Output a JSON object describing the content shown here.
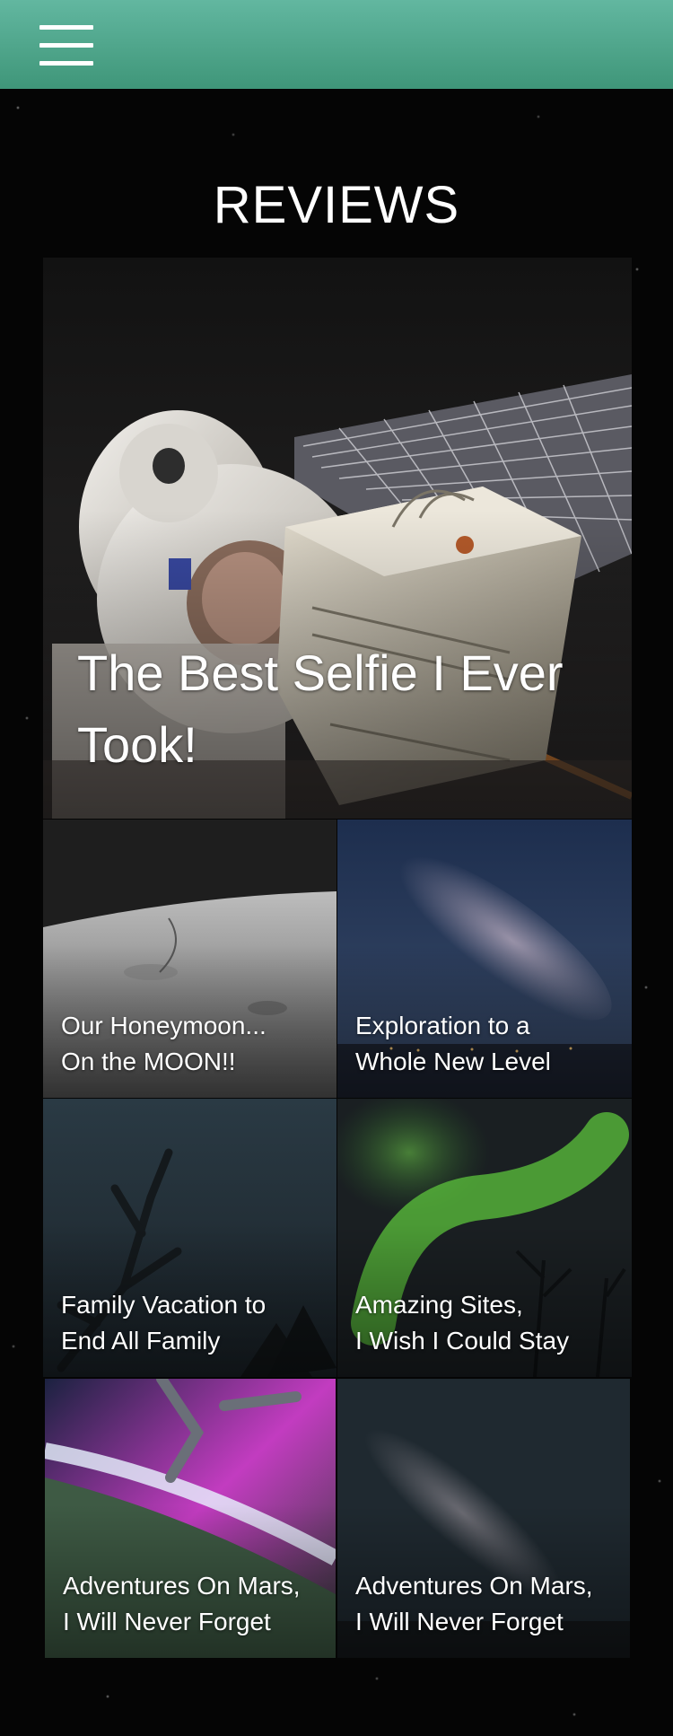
{
  "header": {
    "menu_icon": "hamburger-menu-icon",
    "accent_color": "#4fa88c"
  },
  "page": {
    "title": "REVIEWS"
  },
  "featured": {
    "title": "The Best Selfie I Ever\nTook!"
  },
  "cards": [
    {
      "title": "Our Honeymoon...\nOn the MOON!!"
    },
    {
      "title": "Exploration to a\nWhole New Level"
    },
    {
      "title": "Family Vacation to\nEnd All Family"
    },
    {
      "title": "Amazing Sites,\nI Wish I Could Stay"
    },
    {
      "title": "Adventures On Mars,\nI Will Never Forget"
    },
    {
      "title": "Adventures On Mars,\nI Will Never Forget"
    }
  ]
}
